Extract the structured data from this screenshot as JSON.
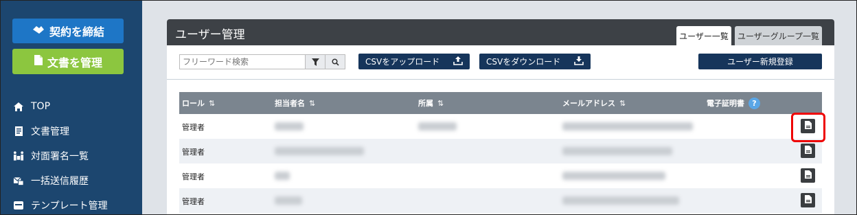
{
  "sidebar": {
    "contract_button": "契約を締結",
    "docs_button": "文書を管理",
    "nav": [
      {
        "label": "TOP",
        "icon": "home-icon"
      },
      {
        "label": "文書管理",
        "icon": "document-icon"
      },
      {
        "label": "対面署名一覧",
        "icon": "face-sign-icon"
      },
      {
        "label": "一括送信履歴",
        "icon": "bulk-send-icon"
      },
      {
        "label": "テンプレート管理",
        "icon": "template-icon"
      }
    ]
  },
  "panel": {
    "title": "ユーザー管理",
    "tabs": [
      "ユーザー一覧",
      "ユーザーグループ一覧"
    ]
  },
  "toolbar": {
    "search_placeholder": "フリーワード検索",
    "upload_label": "CSVをアップロード",
    "download_label": "CSVをダウンロード",
    "register_label": "ユーザー新規登録"
  },
  "table": {
    "headers": [
      "ロール",
      "担当者名",
      "所属",
      "メールアドレス",
      "電子証明書"
    ],
    "help": "?",
    "rows": [
      {
        "role": "管理者"
      },
      {
        "role": "管理者"
      },
      {
        "role": "管理者"
      },
      {
        "role": "管理者"
      }
    ]
  },
  "colors": {
    "sidebar": "#1c466f",
    "primary_button": "#1e76c6",
    "docs_button": "#8cc63f",
    "action_button": "#16355b",
    "highlight": "#ee0000"
  }
}
